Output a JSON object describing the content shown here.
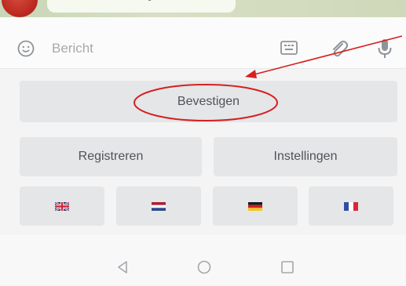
{
  "chat": {
    "avatar_color": "#c0392b"
  },
  "composer": {
    "placeholder": "Bericht",
    "icons": {
      "emoji": "smiley-icon",
      "bot_keyboard": "bot-keyboard-icon",
      "attach": "paperclip-icon",
      "voice": "microphone-icon"
    }
  },
  "keyboard": {
    "rows": [
      {
        "buttons": [
          {
            "label": "Bevestigen"
          }
        ]
      },
      {
        "buttons": [
          {
            "label": "Registreren"
          },
          {
            "label": "Instellingen"
          }
        ]
      },
      {
        "buttons": [
          {
            "flag": "uk-flag-icon"
          },
          {
            "flag": "netherlands-flag-icon"
          },
          {
            "flag": "germany-flag-icon"
          },
          {
            "flag": "france-flag-icon"
          }
        ]
      }
    ]
  },
  "annotation": {
    "color": "#d61f1f",
    "target": "Bevestigen"
  },
  "navigation": {
    "icons": [
      "back-icon",
      "home-icon",
      "recent-apps-icon"
    ]
  }
}
